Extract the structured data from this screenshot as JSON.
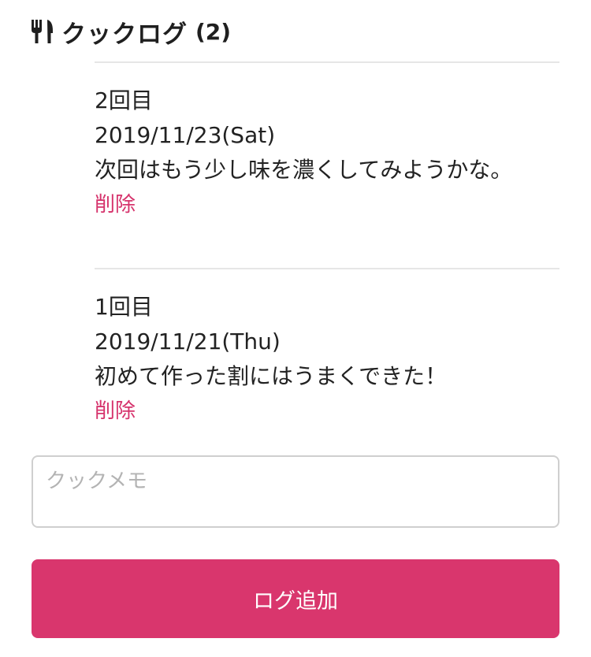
{
  "header": {
    "icon": "fork-knife-icon",
    "title": "クックログ",
    "count": "(2)"
  },
  "logs": [
    {
      "number": "2回目",
      "date": "2019/11/23(Sat)",
      "memo": "次回はもう少し味を濃くしてみようかな。",
      "delete_label": "削除"
    },
    {
      "number": "1回目",
      "date": "2019/11/21(Thu)",
      "memo": "初めて作った割にはうまくできた！",
      "delete_label": "削除"
    }
  ],
  "form": {
    "memo_placeholder": "クックメモ",
    "memo_value": "",
    "submit_label": "ログ追加"
  },
  "colors": {
    "accent": "#d9366d",
    "delete_link": "#d6336c",
    "divider": "#e6e6e6"
  }
}
